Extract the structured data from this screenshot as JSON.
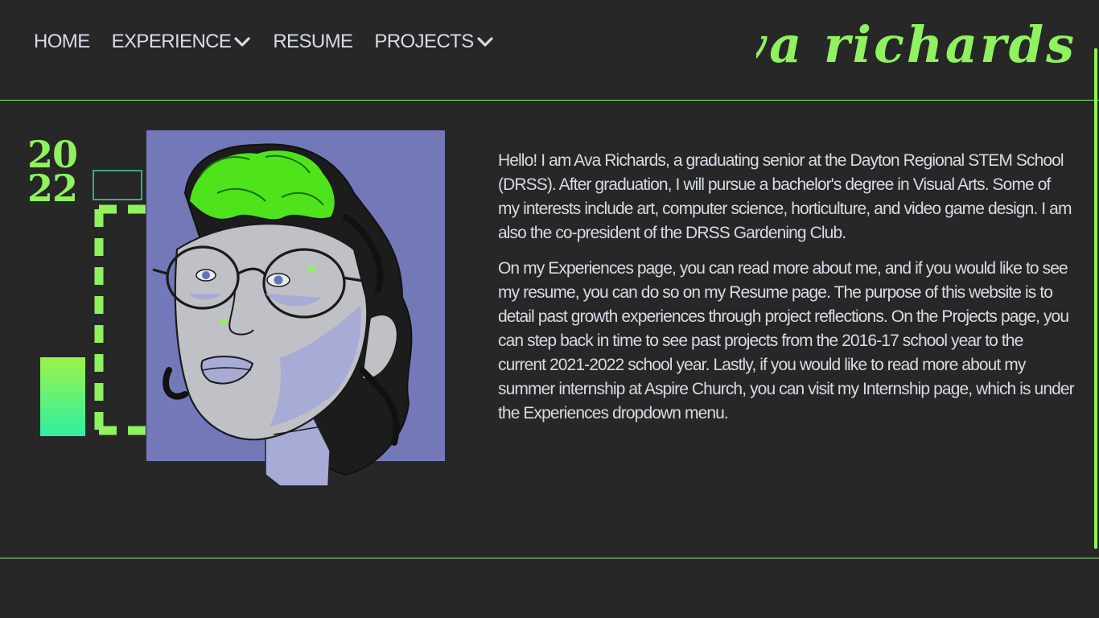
{
  "nav": {
    "items": [
      {
        "label": "HOME",
        "has_dropdown": false
      },
      {
        "label": "EXPERIENCE",
        "has_dropdown": true
      },
      {
        "label": "RESUME",
        "has_dropdown": false
      },
      {
        "label": "PROJECTS",
        "has_dropdown": true
      }
    ]
  },
  "brand": {
    "logo_text": "ava richards"
  },
  "hero": {
    "year_top": "20",
    "year_bottom": "22"
  },
  "bio": {
    "paragraphs": [
      "Hello! I am Ava Richards, a graduating senior at the Dayton Regional STEM School (DRSS). After graduation, I will pursue a bachelor's degree in Visual Arts. Some of my interests include art, computer science, horticulture, and video game design. I am also the co-president of the DRSS Gardening Club.",
      "On my Experiences page, you can read more about me, and if you would like to see my resume, you can do so on my Resume page. The purpose of this website is to detail past growth experiences through project reflections. On the Projects page, you can step back in time to see past projects from the 2016-17 school year to the current 2021-2022 school year. Lastly, if you would like to read more about my summer internship at Aspire Church, you can visit my Internship page, which is under the Experiences dropdown menu."
    ]
  },
  "colors": {
    "background": "#272727",
    "accent": "#8ff25e",
    "text": "#d6dbe6",
    "portrait_bg": "#7379b8",
    "portrait_skin": "#bfc1c6",
    "hair_green": "#4fe31c"
  }
}
